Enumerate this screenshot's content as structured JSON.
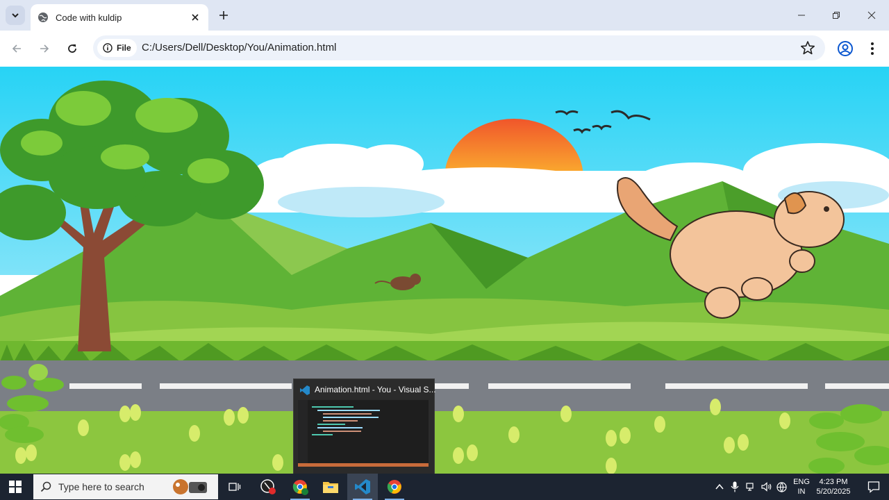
{
  "browser": {
    "tab_title": "Code with kuldip",
    "address_chip": "File",
    "url": "C:/Users/Dell/Desktop/You/Animation.html"
  },
  "taskbar": {
    "search_placeholder": "Type here to search",
    "language_top": "ENG",
    "language_bottom": "IN",
    "time": "4:23 PM",
    "date": "5/20/2025"
  },
  "preview": {
    "title": "Animation.html - You - Visual S..."
  },
  "colors": {
    "sky": "#27d3f5",
    "grass": "#8cc63f",
    "road": "#7b7f86",
    "taskbar": "#1c2431",
    "tab_strip": "#dfe6f3"
  },
  "icons": [
    "tab-search-icon",
    "globe-icon",
    "close-icon",
    "plus-icon",
    "minimize-icon",
    "restore-icon",
    "window-close-icon",
    "back-icon",
    "forward-icon",
    "reload-icon",
    "info-icon",
    "star-icon",
    "profile-icon",
    "menu-icon",
    "windows-icon",
    "search-icon",
    "task-view-icon",
    "vscode-icon",
    "chrome-icon",
    "folder-icon",
    "mic-icon",
    "volume-icon",
    "network-icon",
    "notification-icon"
  ]
}
